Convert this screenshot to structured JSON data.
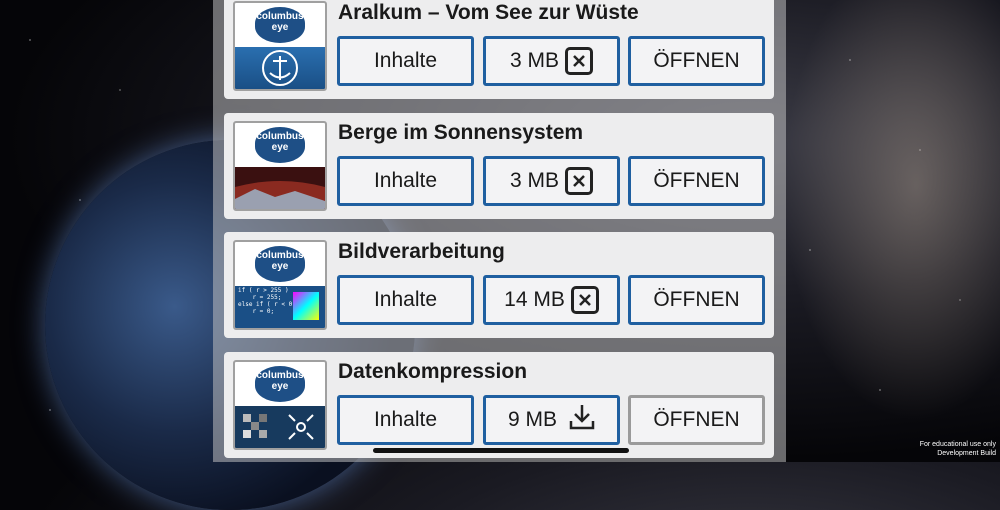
{
  "items": [
    {
      "title": "Aralkum – Vom See zur Wüste",
      "contents_label": "Inhalte",
      "size": "3 MB",
      "size_action": "delete",
      "open_label": "ÖFFNEN",
      "open_enabled": true,
      "thumb": "anchor"
    },
    {
      "title": "Berge im Sonnensystem",
      "contents_label": "Inhalte",
      "size": "3 MB",
      "size_action": "delete",
      "open_label": "ÖFFNEN",
      "open_enabled": true,
      "thumb": "mountains"
    },
    {
      "title": "Bildverarbeitung",
      "contents_label": "Inhalte",
      "size": "14 MB",
      "size_action": "delete",
      "open_label": "ÖFFNEN",
      "open_enabled": true,
      "thumb": "code-cube",
      "thumb_code": "if ( r > 255 )\n    r = 255;\nelse if ( r < 0 )\n    r = 0;"
    },
    {
      "title": "Datenkompression",
      "contents_label": "Inhalte",
      "size": "9 MB",
      "size_action": "download",
      "open_label": "ÖFFNEN",
      "open_enabled": false,
      "thumb": "pixels"
    }
  ],
  "logo_text_line1": "columbus",
  "logo_text_line2": "eye",
  "footer": {
    "line1": "For educational use only",
    "line2": "Development Build"
  },
  "colors": {
    "button_border": "#1f5fa0",
    "disabled_border": "#9a9a9a",
    "logo_bg": "#1e4f86"
  }
}
